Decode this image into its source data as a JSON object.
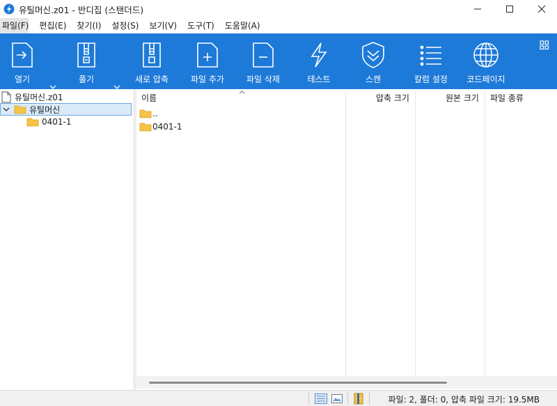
{
  "window": {
    "title": "유틸머신.z01 - 반디집 (스탠더드)"
  },
  "menu": [
    {
      "label": "파일(F)"
    },
    {
      "label": "편집(E)"
    },
    {
      "label": "찾기(I)"
    },
    {
      "label": "설정(S)"
    },
    {
      "label": "보기(V)"
    },
    {
      "label": "도구(T)"
    },
    {
      "label": "도움말(A)"
    }
  ],
  "toolbar": {
    "buttons": [
      {
        "label": "열기",
        "icon": "open-archive-icon"
      },
      {
        "label": "풀기",
        "icon": "extract-zip-icon"
      },
      {
        "label": "새로 압축",
        "icon": "new-archive-icon"
      },
      {
        "label": "파일 추가",
        "icon": "add-file-icon"
      },
      {
        "label": "파일 삭제",
        "icon": "delete-file-icon"
      },
      {
        "label": "테스트",
        "icon": "lightning-icon"
      },
      {
        "label": "스캔",
        "icon": "shield-icon"
      },
      {
        "label": "칼럼 설정",
        "icon": "column-list-icon"
      },
      {
        "label": "코드페이지",
        "icon": "globe-icon"
      }
    ]
  },
  "tree": {
    "archive": "유틸머신.z01",
    "root_folder": "유틸머신",
    "child_folder": "0401-1"
  },
  "filelist": {
    "columns": {
      "name": "이름",
      "packed_size": "압축 크기",
      "original_size": "원본 크기",
      "type": "파일 종류"
    },
    "rows": [
      {
        "name": ".."
      },
      {
        "name": "0401-1"
      }
    ]
  },
  "status": {
    "summary": "파일: 2, 폴더: 0, 압축 파일 크기: 19.5MB"
  },
  "colors": {
    "toolbar_bg": "#1e7ad8",
    "folder": "#f6c344",
    "selection": "#d9ebfa"
  }
}
